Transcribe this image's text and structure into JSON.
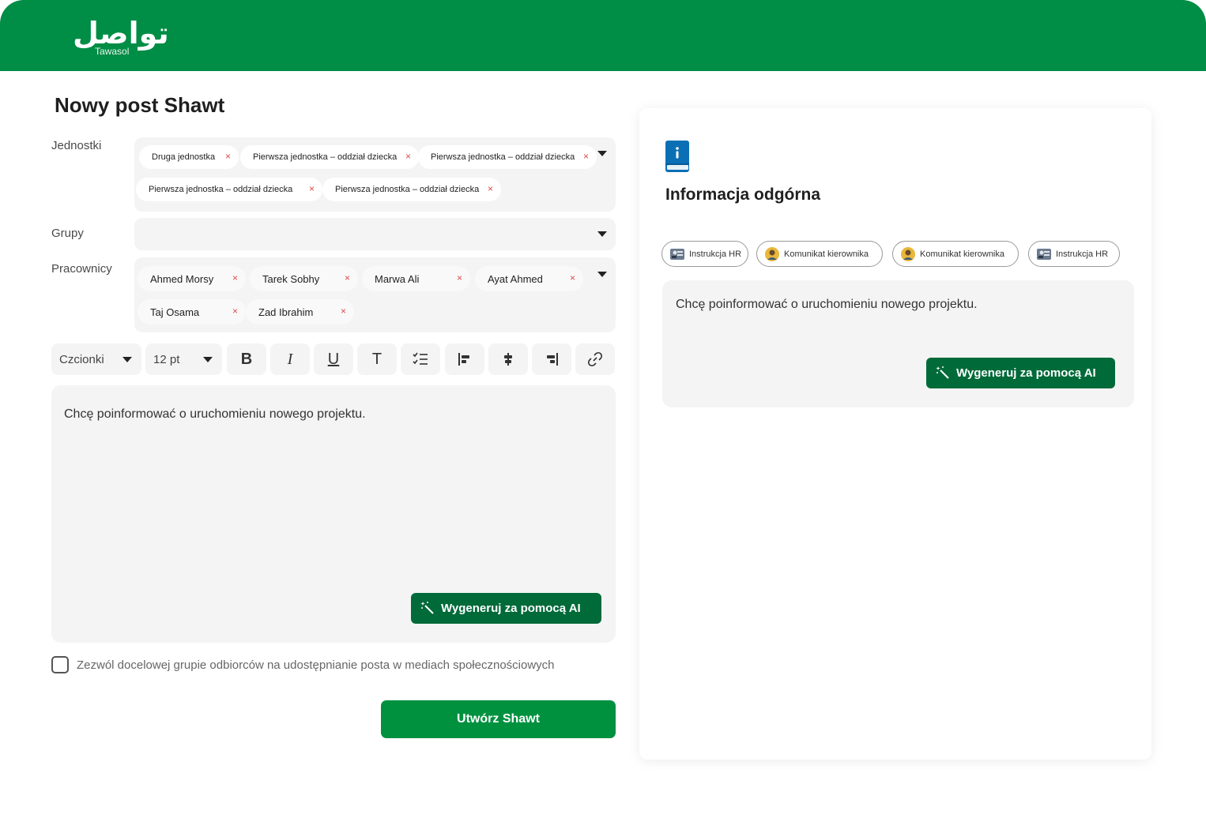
{
  "app": {
    "logo_arabic": "تواصل",
    "logo_latin": "Tawasol",
    "brand_color": "#008d45",
    "button_color": "#006a39"
  },
  "form": {
    "title": "Nowy post Shawt",
    "units": {
      "label": "Jednostki",
      "chips": [
        "Druga jednostka",
        "Pierwsza jednostka – oddział dziecka",
        "Pierwsza jednostka – oddział dziecka",
        "Pierwsza jednostka – oddział dziecka",
        "Pierwsza jednostka – oddział dziecka"
      ]
    },
    "groups": {
      "label": "Grupy",
      "value": ""
    },
    "employees": {
      "label": "Pracownicy",
      "chips": [
        "Ahmed Morsy",
        "Tarek Sobhy",
        "Marwa Ali",
        "Ayat Ahmed",
        "Taj Osama",
        "Zad Ibrahim"
      ]
    },
    "remove_glyph": "×",
    "toolbar": {
      "font_select": "Czcionki",
      "size_select": "12 pt",
      "bold_glyph": "B",
      "italic_glyph": "I",
      "underline_glyph": "U",
      "text_glyph": "T"
    },
    "editor_text": "Chcę poinformować o uruchomieniu nowego projektu.",
    "ai_button": "Wygeneruj za pomocą AI",
    "share_checkbox": {
      "label": "Zezwól docelowej grupie odbiorców na udostępnianie posta w mediach społecznościowych",
      "checked": false
    },
    "submit": "Utwórz Shawt"
  },
  "preview": {
    "title": "Informacja odgórna",
    "tags": [
      {
        "label": "Instrukcja HR",
        "icon": "hr-icon"
      },
      {
        "label": "Komunikat kierownika",
        "icon": "manager-icon"
      },
      {
        "label": "Komunikat kierownika",
        "icon": "manager-icon"
      },
      {
        "label": "Instrukcja HR",
        "icon": "hr-icon"
      }
    ],
    "text": "Chcę poinformować o uruchomieniu nowego projektu.",
    "ai_button": "Wygeneruj za pomocą AI"
  }
}
